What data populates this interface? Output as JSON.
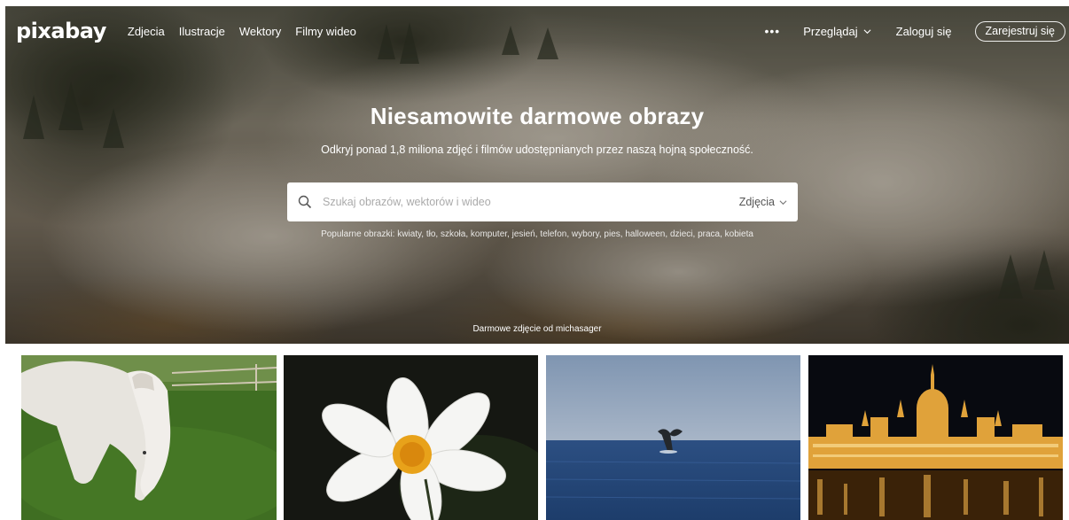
{
  "brand": {
    "logo_text": "pixabay"
  },
  "nav": {
    "links": [
      {
        "label": "Zdjecia"
      },
      {
        "label": "Ilustracje"
      },
      {
        "label": "Wektory"
      },
      {
        "label": "Filmy wideo"
      }
    ],
    "more": "•••",
    "browse_label": "Przeglądaj",
    "login_label": "Zaloguj się",
    "register_label": "Zarejestruj się"
  },
  "hero": {
    "title": "Niesamowite darmowe obrazy",
    "subtitle": "Odkryj ponad 1,8 miliona zdjęć i filmów udostępnianych przez naszą hojną społeczność.",
    "search": {
      "placeholder": "Szukaj obrazów, wektorów i wideo",
      "value": "",
      "type_selected": "Zdjęcia"
    },
    "popular_label": "Popularne obrazki:",
    "popular_tags": [
      "kwiaty",
      "tło",
      "szkoła",
      "komputer",
      "jesień",
      "telefon",
      "wybory",
      "pies",
      "halloween",
      "dzieci",
      "praca",
      "kobieta"
    ],
    "credit_prefix": "Darmowe zdjęcie od",
    "credit_author": "michasager"
  },
  "thumbnails": [
    {
      "subject": "horse-grazing"
    },
    {
      "subject": "white-cosmos-flower"
    },
    {
      "subject": "whale-tail-sea"
    },
    {
      "subject": "parliament-night"
    }
  ],
  "colors": {
    "text_on_hero": "#ffffff",
    "search_bg": "#ffffff",
    "placeholder": "#aaaaaa"
  }
}
